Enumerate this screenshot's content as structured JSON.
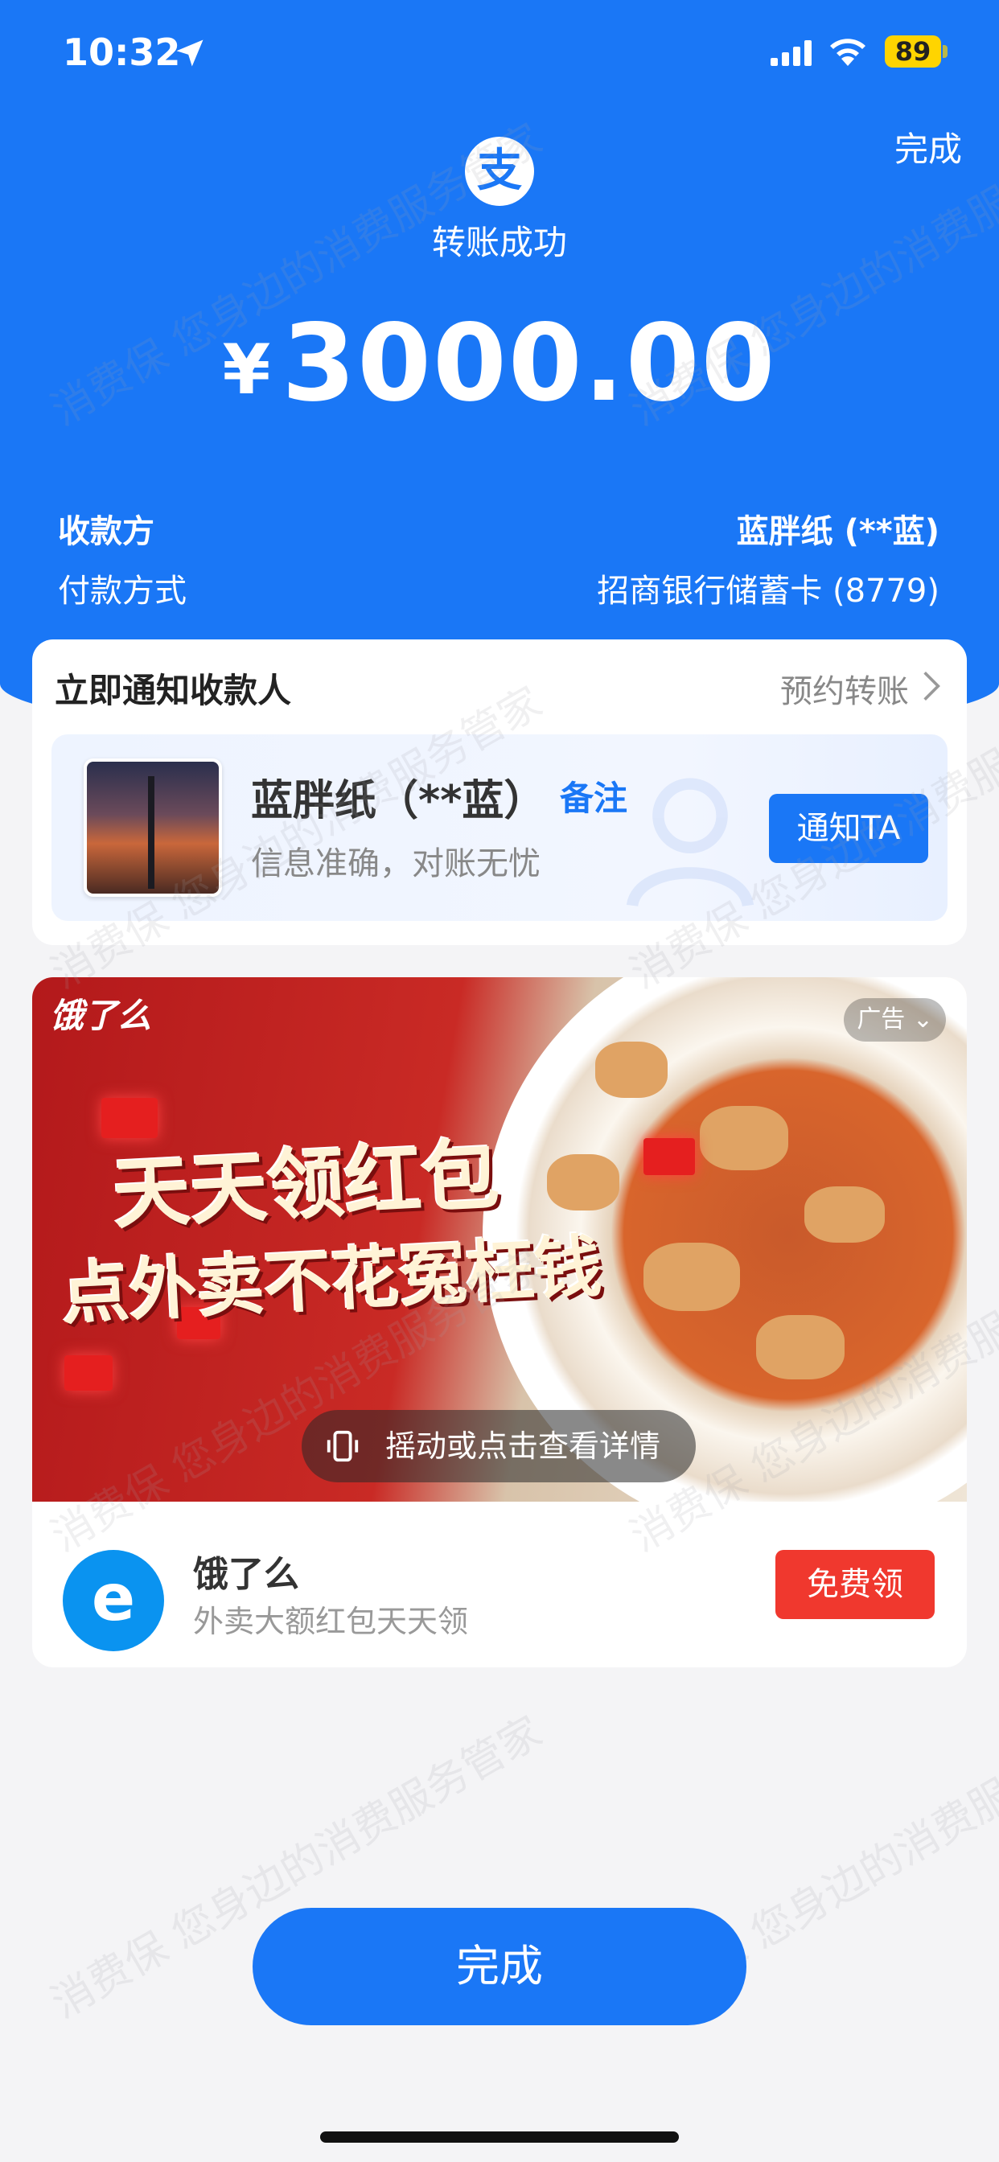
{
  "status_bar": {
    "time": "10:32",
    "battery": "89"
  },
  "header": {
    "done_label": "完成",
    "logo_char": "支",
    "title": "转账成功",
    "currency": "¥",
    "amount": "3000.00"
  },
  "details": {
    "payee_label": "收款方",
    "payee_value": "蓝胖纸 (**蓝)",
    "method_label": "付款方式",
    "method_value": "招商银行储蓄卡 (8779)"
  },
  "notify": {
    "title": "立即通知收款人",
    "schedule": "预约转账",
    "name": "蓝胖纸（**蓝）",
    "remark": "备注",
    "note": "信息准确，对账无忧",
    "button": "通知TA"
  },
  "ad": {
    "logo": "饿了么",
    "tag": "广告",
    "headline1": "天天领红包",
    "headline2": "点外卖不花冤枉钱",
    "shake_hint": "摇动或点击查看详情",
    "brand_name": "饿了么",
    "brand_desc": "外卖大额红包天天领",
    "claim_button": "免费领",
    "brand_logo_char": "e"
  },
  "bottom": {
    "done_label": "完成"
  },
  "watermark": "消费保 您身边的消费服务管家",
  "colors": {
    "primary_blue": "#1a77f6",
    "eleme_blue": "#0a93f0",
    "claim_red": "#f0382e"
  }
}
